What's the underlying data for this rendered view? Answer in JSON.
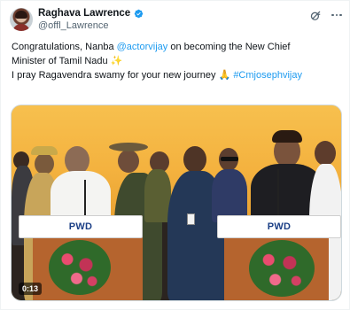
{
  "tweet": {
    "display_name": "Raghava Lawrence",
    "handle": "@offl_Lawrence",
    "verified": true,
    "text": {
      "line1_prefix": "Congratulations, Nanba ",
      "mention": "@actorvijay",
      "line1_suffix": " on becoming the New Chief",
      "line2": "Minister of Tamil Nadu ✨",
      "line3_prefix": "I pray Ragavendra swamy for your new journey 🙏 ",
      "hashtag": "#Cmjosephvijay"
    }
  },
  "media": {
    "podium_left_label": "PWD",
    "podium_right_label": "PWD",
    "video_time": "0:13"
  },
  "icons": {
    "verified": "verified-badge-icon",
    "grok": "grok-icon",
    "more": "more-options-icon"
  },
  "colors": {
    "link": "#1d9bf0",
    "verified": "#1d9bf0",
    "secondary_text": "#536471"
  }
}
